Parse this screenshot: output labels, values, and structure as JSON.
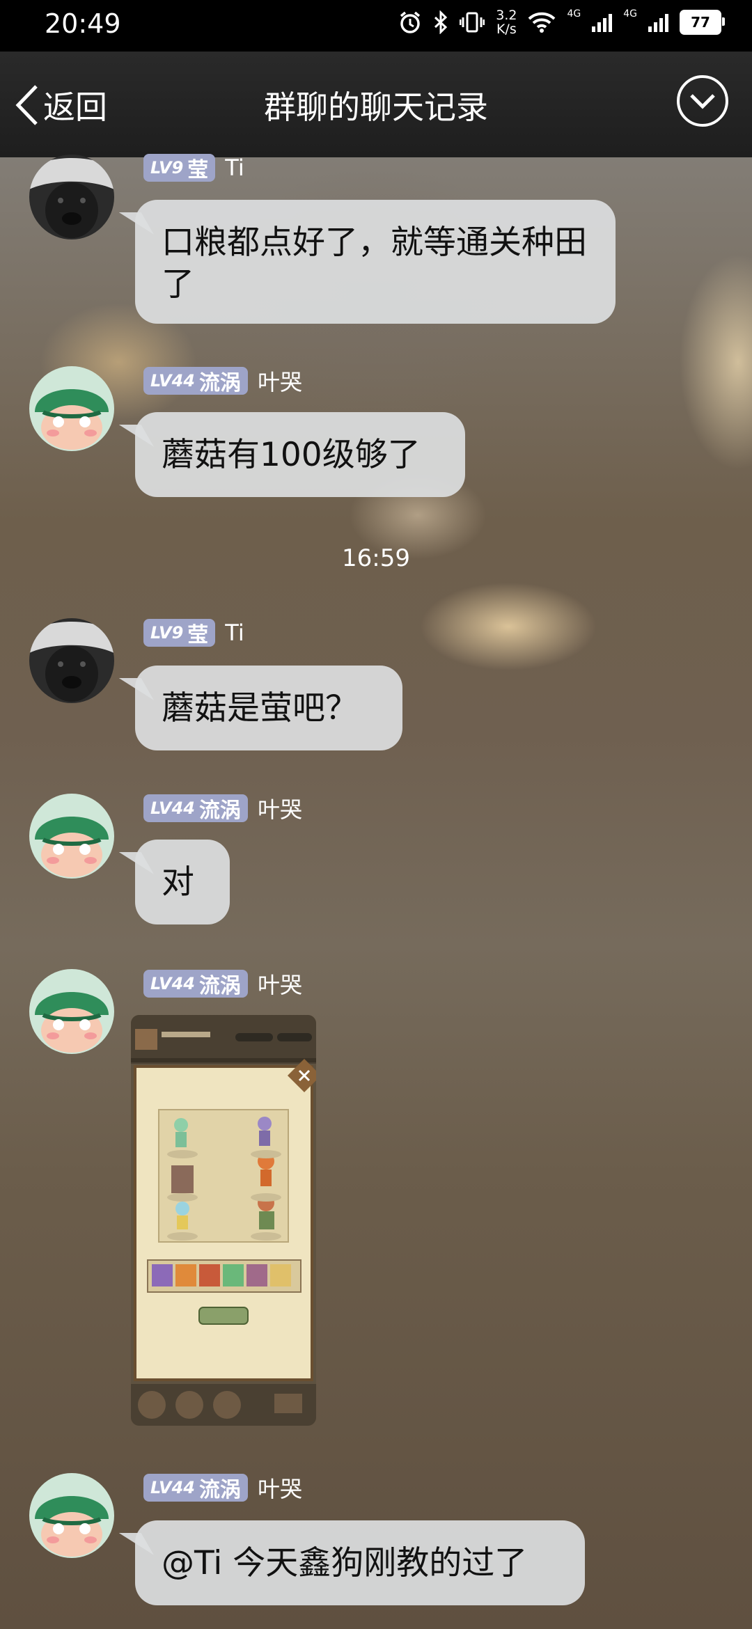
{
  "status_bar": {
    "time": "20:49",
    "speed_value": "3.2",
    "speed_unit": "K/s",
    "net_label_1": "4G",
    "net_label_2": "4G",
    "battery": "77"
  },
  "nav": {
    "back_label": "返回",
    "title": "群聊的聊天记录"
  },
  "messages": [
    {
      "level": "LV9",
      "title": "莹",
      "nick": "Ti",
      "text": "口粮都点好了，就等通关种田了"
    },
    {
      "level": "LV44",
      "title": "流涡",
      "nick": "叶哭",
      "text": "蘑菇有100级够了"
    },
    {
      "level": "LV9",
      "title": "莹",
      "nick": "Ti",
      "text": "蘑菇是萤吧？"
    },
    {
      "level": "LV44",
      "title": "流涡",
      "nick": "叶哭",
      "text": "对"
    },
    {
      "level": "LV44",
      "title": "流涡",
      "nick": "叶哭"
    },
    {
      "level": "LV44",
      "title": "流涡",
      "nick": "叶哭",
      "text": "@Ti 今天鑫狗刚教的过了"
    }
  ],
  "time_separator": "16:59",
  "colors": {
    "badge": "#9ea4c8",
    "bubble": "#dcdee0",
    "navbar": "#222222"
  }
}
